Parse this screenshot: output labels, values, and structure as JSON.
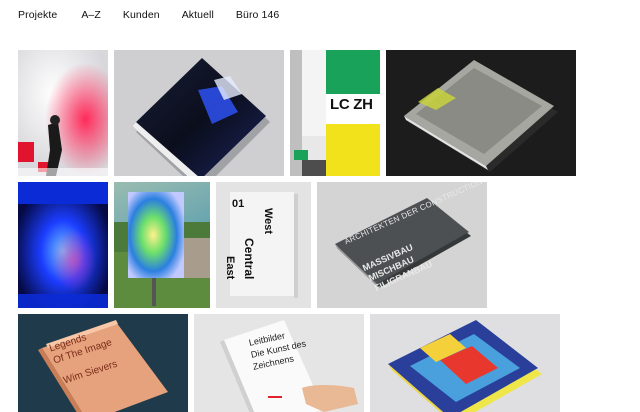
{
  "nav": {
    "items": [
      "Projekte",
      "A–Z",
      "Kunden",
      "Aktuell",
      "Büro 146"
    ]
  },
  "projects": {
    "lczh_logo": "LC ZH",
    "central_number": "01",
    "central_west": "West",
    "central_central": "Central",
    "central_east": "East",
    "archi_title": "ARCHITEKTEN DER CONSTRUCTION",
    "archi_sub1": "MASSIVBAU",
    "archi_sub2": "MISCHBAU",
    "archi_sub3": "FILIGRANBAU",
    "legends_line1": "Legends",
    "legends_line2": "Of The Image",
    "legends_author": "Wim Sievers",
    "leitbilder_line1": "Leitbilder",
    "leitbilder_line2": "Die Kunst des",
    "leitbilder_line3": "Zeichnens"
  },
  "colors": {
    "background": "#ffffff",
    "text": "#111111"
  }
}
